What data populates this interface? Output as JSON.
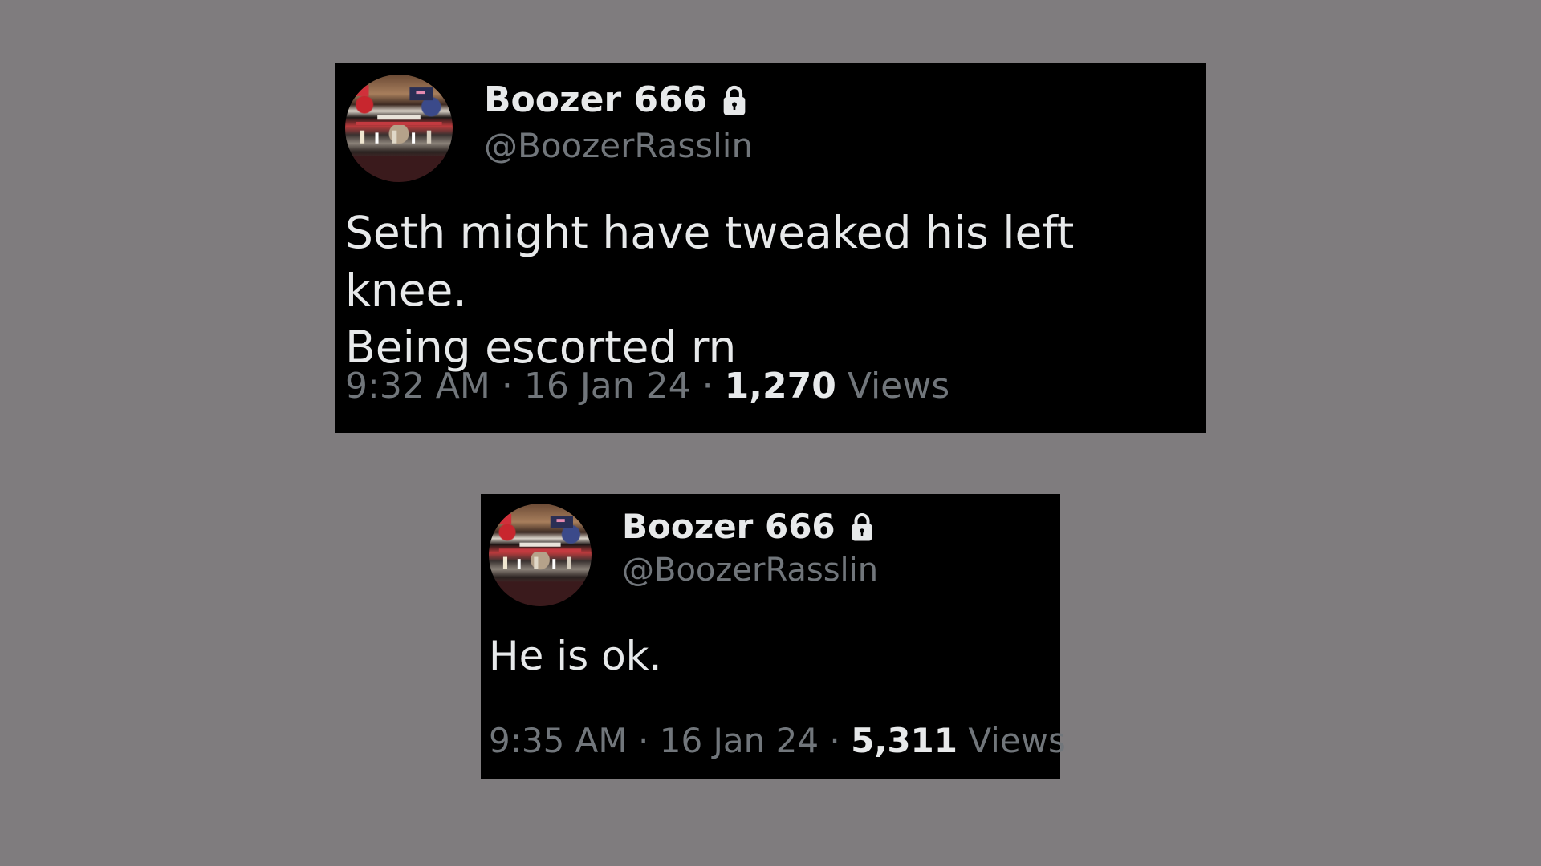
{
  "tweets": [
    {
      "display_name": "Boozer 666",
      "handle": "@BoozerRasslin",
      "text_lines": [
        "Seth might have tweaked his left knee.",
        "Being escorted rn"
      ],
      "time": "9:32 AM",
      "date": "16 Jan 24",
      "separator": "·",
      "views_count": "1,270",
      "views_label": "Views",
      "protected_icon": "lock-icon"
    },
    {
      "display_name": "Boozer 666",
      "handle": "@BoozerRasslin",
      "text_lines": [
        "He is ok."
      ],
      "time": "9:35 AM",
      "date": "16 Jan 24",
      "separator": "·",
      "views_count": "5,311",
      "views_label": "Views",
      "protected_icon": "lock-icon"
    }
  ],
  "colors": {
    "page_background": "#7f7c7e",
    "card_background": "#000000",
    "primary_text": "#e7e9ea",
    "secondary_text": "#71767b"
  }
}
